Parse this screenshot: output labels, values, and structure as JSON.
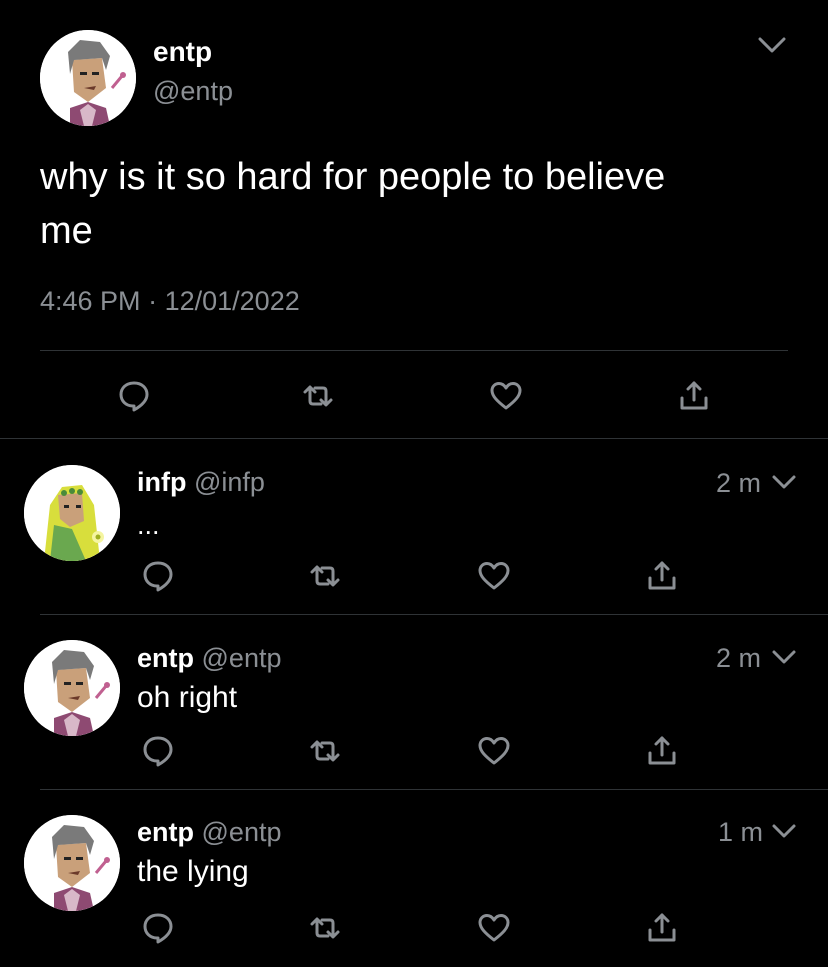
{
  "main_tweet": {
    "display_name": "entp",
    "handle": "@entp",
    "text_line1": "why is it so hard for people to believe",
    "text_line2": "me",
    "time": "4:46 PM",
    "separator": "·",
    "date": "12/01/2022"
  },
  "replies": [
    {
      "display_name": "infp",
      "handle": "@infp",
      "age": "2 m",
      "text": "..."
    },
    {
      "display_name": "entp",
      "handle": "@entp",
      "age": "2 m",
      "text": "oh right"
    },
    {
      "display_name": "entp",
      "handle": "@entp",
      "age": "1 m",
      "text": "the lying"
    }
  ],
  "icons": {
    "reply": "reply-icon",
    "retweet": "retweet-icon",
    "like": "heart-icon",
    "share": "share-icon",
    "menu": "chevron-down-icon"
  },
  "colors": {
    "background": "#000000",
    "text": "#ffffff",
    "secondary": "#8b8f94",
    "icon": "#8b8f94",
    "divider": "#2f3336"
  }
}
